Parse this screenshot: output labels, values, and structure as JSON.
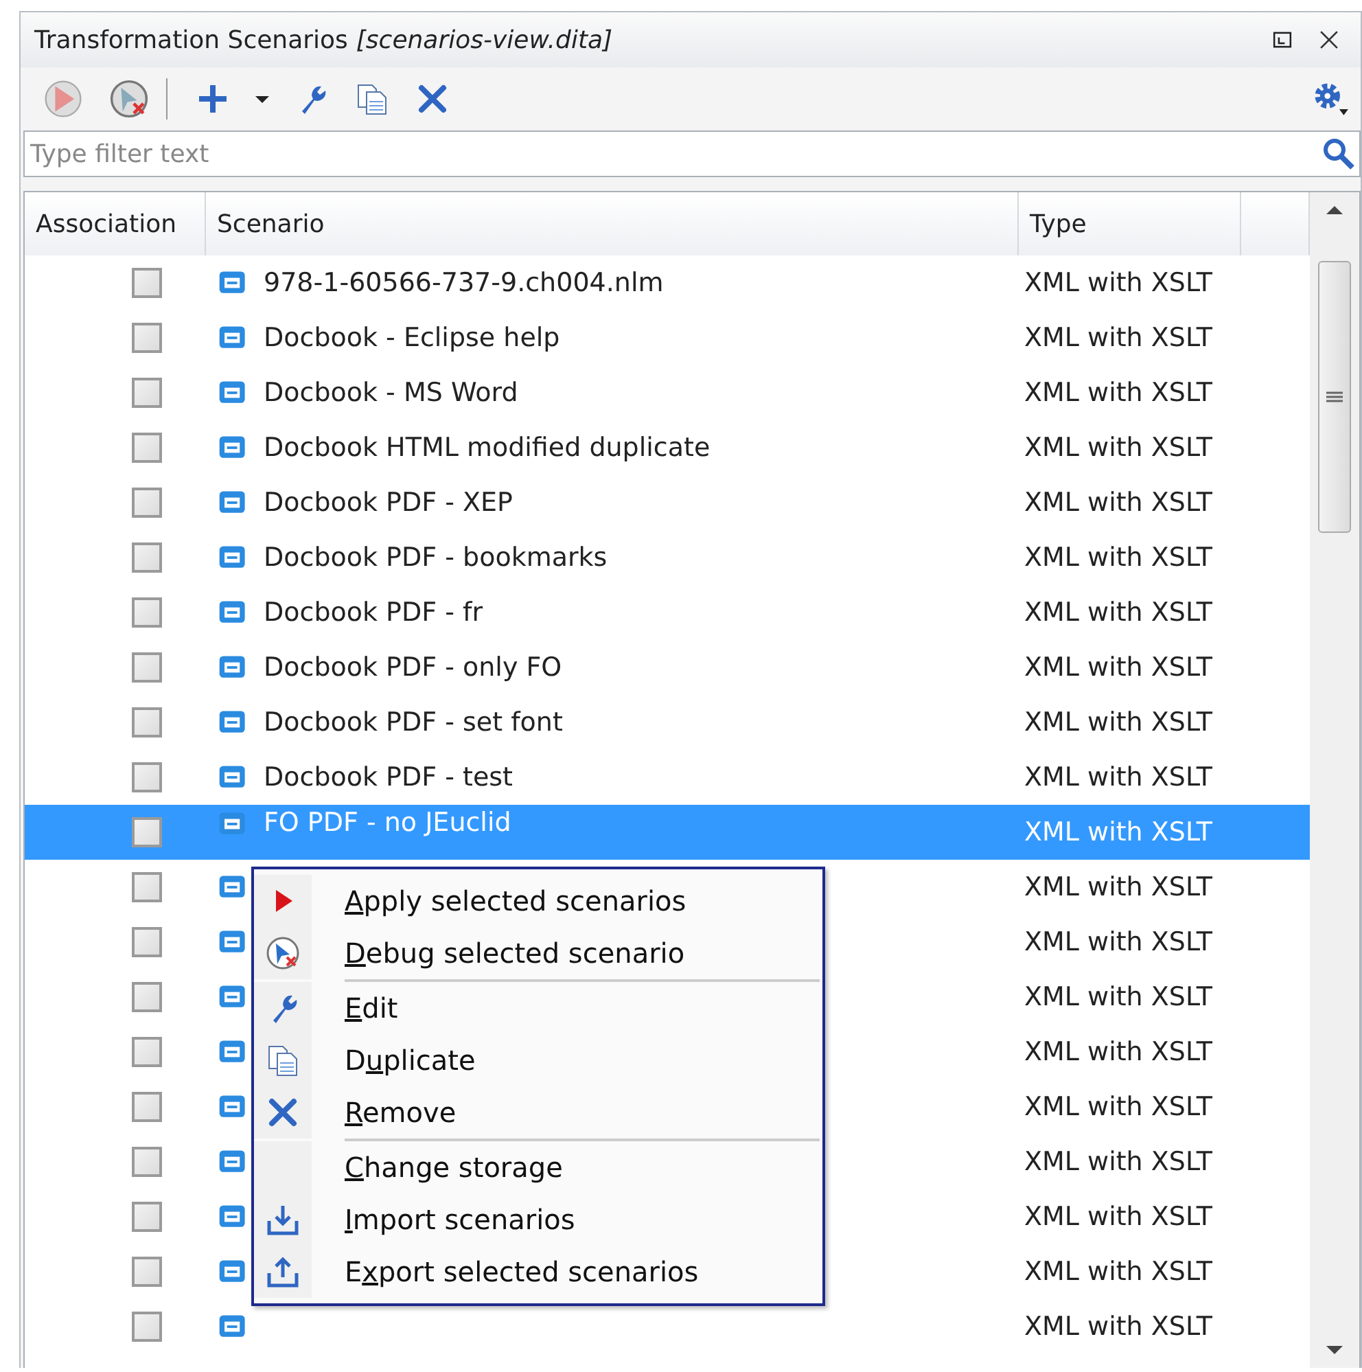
{
  "panel": {
    "title": "Transformation Scenarios",
    "file": "[scenarios-view.dita]"
  },
  "filter": {
    "placeholder": "Type filter text"
  },
  "table": {
    "columns": [
      "Association",
      "Scenario",
      "Type"
    ],
    "rows": [
      {
        "checked": false,
        "selected": false,
        "scenario": "978-1-60566-737-9.ch004.nlm",
        "type": "XML with XSLT"
      },
      {
        "checked": false,
        "selected": false,
        "scenario": "Docbook - Eclipse help",
        "type": "XML with XSLT"
      },
      {
        "checked": false,
        "selected": false,
        "scenario": "Docbook - MS Word",
        "type": "XML with XSLT"
      },
      {
        "checked": false,
        "selected": false,
        "scenario": "Docbook HTML modified duplicate",
        "type": "XML with XSLT"
      },
      {
        "checked": false,
        "selected": false,
        "scenario": "Docbook PDF - XEP",
        "type": "XML with XSLT"
      },
      {
        "checked": false,
        "selected": false,
        "scenario": "Docbook PDF - bookmarks",
        "type": "XML with XSLT"
      },
      {
        "checked": false,
        "selected": false,
        "scenario": "Docbook PDF - fr",
        "type": "XML with XSLT"
      },
      {
        "checked": false,
        "selected": false,
        "scenario": "Docbook PDF - only FO",
        "type": "XML with XSLT"
      },
      {
        "checked": false,
        "selected": false,
        "scenario": "Docbook PDF - set font",
        "type": "XML with XSLT"
      },
      {
        "checked": false,
        "selected": false,
        "scenario": "Docbook PDF - test",
        "type": "XML with XSLT"
      },
      {
        "checked": false,
        "selected": true,
        "scenario": "FO PDF - no JEuclid",
        "type": "XML with XSLT"
      },
      {
        "checked": false,
        "selected": false,
        "type": "XML with XSLT"
      },
      {
        "checked": false,
        "selected": false,
        "type": "XML with XSLT"
      },
      {
        "checked": false,
        "selected": false,
        "type": "XML with XSLT"
      },
      {
        "checked": false,
        "selected": false,
        "type": "XML with XSLT"
      },
      {
        "checked": false,
        "selected": false,
        "type": "XML with XSLT"
      },
      {
        "checked": false,
        "selected": false,
        "type": "XML with XSLT"
      },
      {
        "checked": false,
        "selected": false,
        "type": "XML with XSLT"
      },
      {
        "checked": false,
        "selected": false,
        "type": "XML with XSLT"
      },
      {
        "checked": false,
        "selected": false,
        "type": "XML with XSLT"
      }
    ]
  },
  "context_menu": {
    "items": [
      {
        "kind": "item",
        "label": "Apply selected scenarios"
      },
      {
        "kind": "item",
        "label": "Debug selected scenario"
      },
      {
        "kind": "separator"
      },
      {
        "kind": "item",
        "label": "Edit"
      },
      {
        "kind": "item",
        "label": "Duplicate"
      },
      {
        "kind": "item",
        "label": "Remove"
      },
      {
        "kind": "separator"
      },
      {
        "kind": "item",
        "label": "Change storage"
      },
      {
        "kind": "item",
        "label": "Import scenarios"
      },
      {
        "kind": "item",
        "label": "Export selected scenarios"
      }
    ]
  }
}
